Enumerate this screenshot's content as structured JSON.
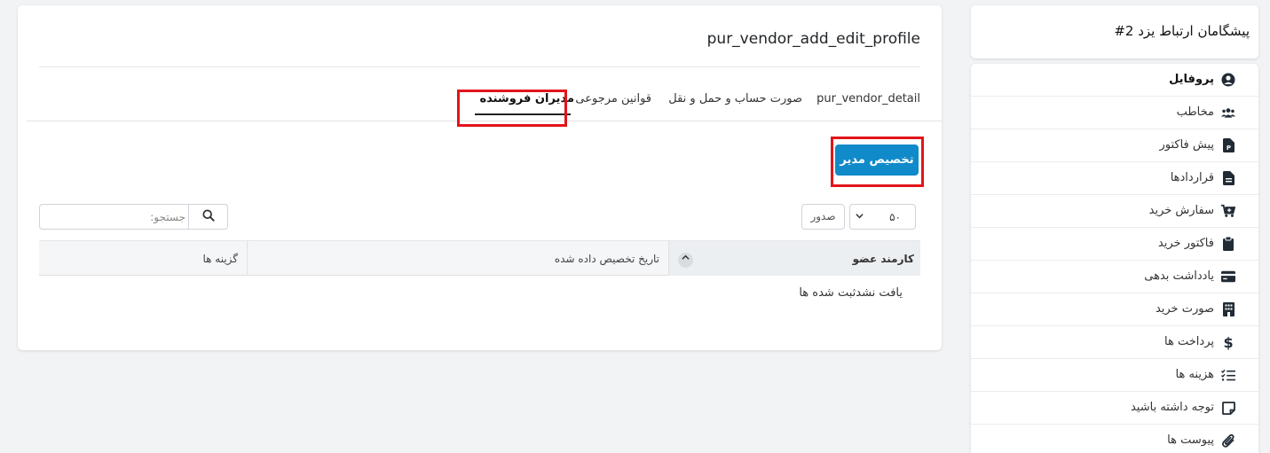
{
  "page": {
    "title": "pur_vendor_add_edit_profile"
  },
  "tabs": [
    {
      "label": "pur_vendor_detail"
    },
    {
      "label": "صورت حساب و حمل و نقل"
    },
    {
      "label": "قوانین مرجوعی"
    },
    {
      "label": "مدیران فروشنده",
      "active": true
    }
  ],
  "toolbar": {
    "assign_label": "تخصیص مدیر"
  },
  "table_controls": {
    "length_value": "۵۰",
    "length_label": "صدور",
    "search_placeholder": "جستجو:"
  },
  "table": {
    "columns": [
      "کارمند عضو",
      "تاریخ تخصیص داده شده",
      "گزینه ها"
    ],
    "empty_message": "یافت نشدثبت شده ها"
  },
  "company": {
    "name": "#2 پیشگامان ارتباط یزد"
  },
  "sidebar": {
    "items": [
      {
        "label": "پروفایل",
        "icon": "user-circle-icon",
        "active": true
      },
      {
        "label": "مخاطب",
        "icon": "users-icon"
      },
      {
        "label": "پیش فاکتور",
        "icon": "file-invoice-icon"
      },
      {
        "label": "قراردادها",
        "icon": "file-contract-icon"
      },
      {
        "label": "سفارش خرید",
        "icon": "cart-plus-icon"
      },
      {
        "label": "فاکتور خرید",
        "icon": "clipboard-icon"
      },
      {
        "label": "یادداشت بدهی",
        "icon": "credit-card-icon"
      },
      {
        "label": "صورت خرید",
        "icon": "building-icon"
      },
      {
        "label": "پرداخت ها",
        "icon": "dollar-icon"
      },
      {
        "label": "هزینه ها",
        "icon": "list-check-icon"
      },
      {
        "label": "توجه داشته باشید",
        "icon": "sticky-note-icon"
      },
      {
        "label": "پیوست ها",
        "icon": "paperclip-icon"
      }
    ]
  },
  "colors": {
    "accent": "#118ac9",
    "highlight": "#e3141b",
    "icon": "#212b36"
  }
}
